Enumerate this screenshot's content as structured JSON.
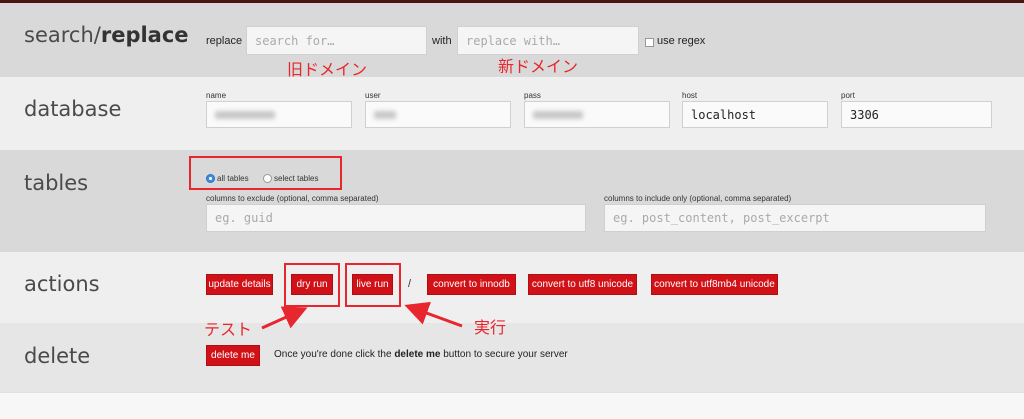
{
  "header": {
    "title_part1": "search/",
    "title_part2": "replace",
    "replace_label": "replace",
    "replace_placeholder": "search for…",
    "with_label": "with",
    "with_placeholder": "replace with…",
    "regex_label": "use regex"
  },
  "annotations": {
    "old_domain": "旧ドメイン",
    "new_domain": "新ドメイン",
    "test": "テスト",
    "execute": "実行"
  },
  "database": {
    "title": "database",
    "fields": [
      {
        "label": "name",
        "value": ""
      },
      {
        "label": "user",
        "value": ""
      },
      {
        "label": "pass",
        "value": ""
      },
      {
        "label": "host",
        "value": "localhost"
      },
      {
        "label": "port",
        "value": "3306"
      }
    ]
  },
  "tables": {
    "title": "tables",
    "all_label": "all tables",
    "select_label": "select tables",
    "exclude_label": "columns to exclude (optional, comma separated)",
    "exclude_placeholder": "eg. guid",
    "include_label": "columns to include only (optional, comma separated)",
    "include_placeholder": "eg. post_content, post_excerpt"
  },
  "actions": {
    "title": "actions",
    "update": "update details",
    "dry_run": "dry run",
    "separator": "/",
    "live_run": "live run",
    "innodb": "convert to innodb",
    "utf8": "convert to utf8 unicode",
    "utf8mb4": "convert to utf8mb4 unicode"
  },
  "delete": {
    "title": "delete",
    "button": "delete me",
    "desc_before": "Once you're done click the ",
    "desc_bold": "delete me",
    "desc_after": " button to secure your server"
  },
  "colors": {
    "accent": "#d01218",
    "annotation": "#e8262d",
    "radio_selected": "#3d8ee5"
  }
}
